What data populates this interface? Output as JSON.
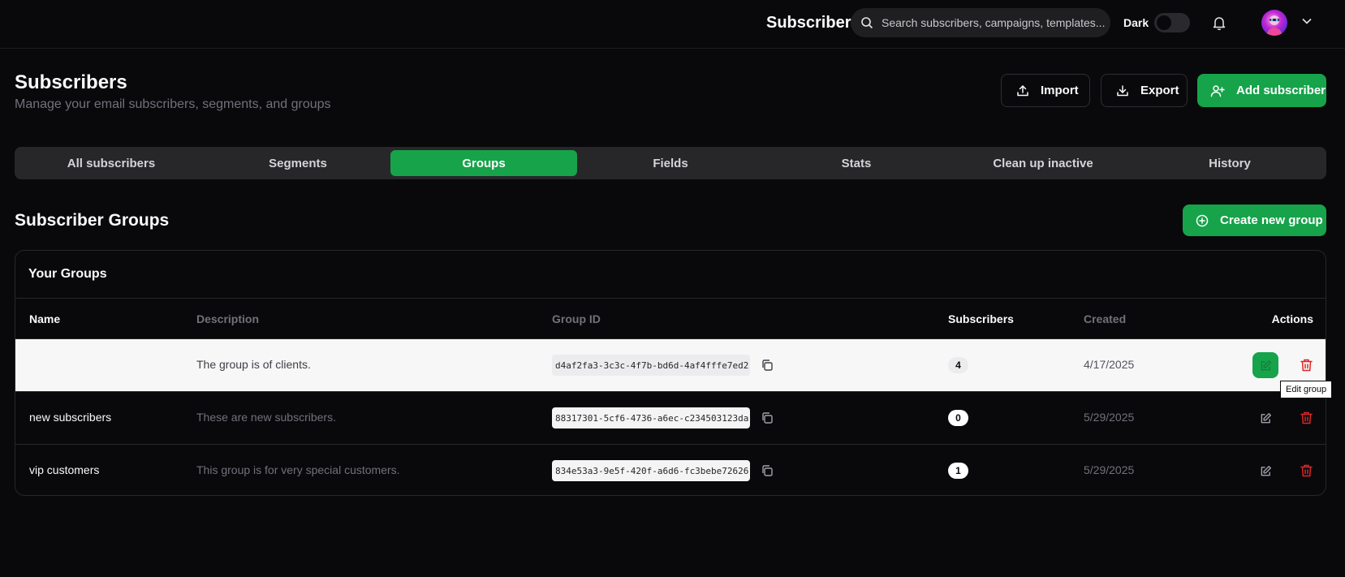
{
  "topbar": {
    "title": "Subscribers",
    "search_placeholder": "Search subscribers, campaigns, templates...",
    "dark_label": "Dark",
    "dark_mode_on": false,
    "icons": [
      "search-icon",
      "bell-icon",
      "chevron-down-icon"
    ]
  },
  "header": {
    "title": "Subscribers",
    "subtitle": "Manage your email subscribers, segments, and groups",
    "import_label": "Import",
    "export_label": "Export",
    "add_label": "Add subscriber"
  },
  "tabs": [
    "All subscribers",
    "Segments",
    "Groups",
    "Fields",
    "Stats",
    "Clean up inactive",
    "History"
  ],
  "active_tab": "Groups",
  "section": {
    "title": "Subscriber Groups",
    "create_label": "Create new group"
  },
  "card": {
    "title": "Your Groups",
    "columns": {
      "name": "Name",
      "description": "Description",
      "group_id": "Group ID",
      "subscribers": "Subscribers",
      "created": "Created",
      "actions": "Actions"
    },
    "rows": [
      {
        "name": "",
        "description": "The group is of clients.",
        "group_id": "d4af2fa3-3c3c-4f7b-bd6d-4af4fffe7ed2",
        "subscribers": "4",
        "created": "4/17/2025"
      },
      {
        "name": "new subscribers",
        "description": "These are new subscribers.",
        "group_id": "88317301-5cf6-4736-a6ec-c234503123da",
        "subscribers": "0",
        "created": "5/29/2025"
      },
      {
        "name": "vip customers",
        "description": "This group is for very special customers.",
        "group_id": "834e53a3-9e5f-420f-a6d6-fc3bebe72626",
        "subscribers": "1",
        "created": "5/29/2025"
      }
    ]
  },
  "tooltip": "Edit group",
  "colors": {
    "background": "#09090b",
    "accent": "#16a34a",
    "danger": "#dc2626",
    "muted": "#71717a"
  }
}
